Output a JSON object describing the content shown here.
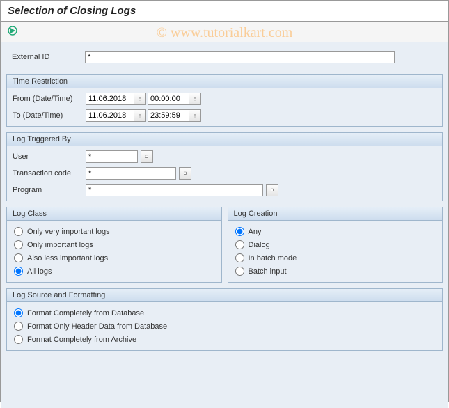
{
  "title": "Selection of Closing Logs",
  "watermark": "© www.tutorialkart.com",
  "external_id": {
    "label": "External ID",
    "value": "*"
  },
  "time_restriction": {
    "title": "Time Restriction",
    "from": {
      "label": "From (Date/Time)",
      "date": "11.06.2018",
      "time": "00:00:00"
    },
    "to": {
      "label": "To (Date/Time)",
      "date": "11.06.2018",
      "time": "23:59:59"
    }
  },
  "log_triggered": {
    "title": "Log Triggered By",
    "user": {
      "label": "User",
      "value": "*"
    },
    "tcode": {
      "label": "Transaction code",
      "value": "*"
    },
    "program": {
      "label": "Program",
      "value": "*"
    }
  },
  "log_class": {
    "title": "Log Class",
    "options": {
      "o1": "Only very important logs",
      "o2": "Only important logs",
      "o3": "Also less important logs",
      "o4": "All logs"
    },
    "selected": "o4"
  },
  "log_creation": {
    "title": "Log Creation",
    "options": {
      "c1": "Any",
      "c2": "Dialog",
      "c3": "In batch mode",
      "c4": "Batch input"
    },
    "selected": "c1"
  },
  "log_source": {
    "title": "Log Source and Formatting",
    "options": {
      "s1": "Format Completely from Database",
      "s2": "Format Only Header Data from Database",
      "s3": "Format Completely from Archive"
    },
    "selected": "s1"
  }
}
